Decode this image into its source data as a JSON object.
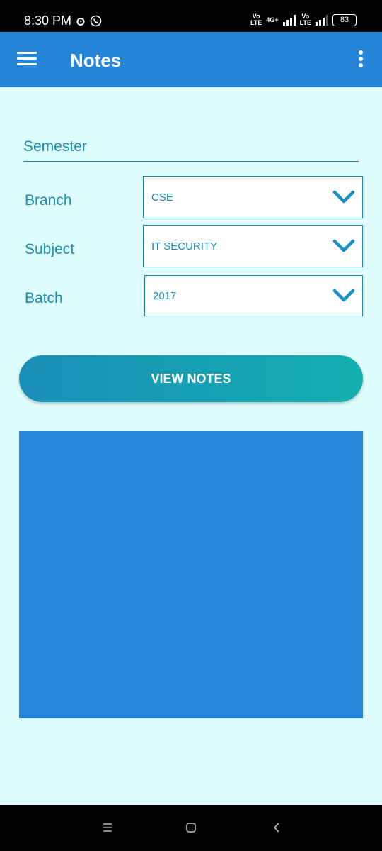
{
  "status_bar": {
    "time": "8:30 PM",
    "icons": [
      "alarm-icon",
      "whatsapp-icon"
    ],
    "sim1_label_top": "Vo)) LTE",
    "network_label": "4G+",
    "sim2_label": "Vo)) LTE",
    "battery": "83"
  },
  "app_bar": {
    "title": "Notes",
    "menu_icon": "hamburger-menu-icon",
    "overflow_icon": "more-vert-icon",
    "color": "#2785d8"
  },
  "form": {
    "semester_label": "Semester",
    "rows": [
      {
        "label": "Branch",
        "value": "CSE"
      },
      {
        "label": "Subject",
        "value": "IT SECURITY"
      },
      {
        "label": "Batch",
        "value": "2017"
      }
    ]
  },
  "action": {
    "view_notes_label": "VIEW NOTES"
  },
  "nav": {
    "recents": "recents-icon",
    "home": "home-icon",
    "back": "back-icon"
  },
  "colors": {
    "background": "#e0fdfd",
    "accent_text": "#1a8fb2",
    "panel": "#2787da"
  }
}
